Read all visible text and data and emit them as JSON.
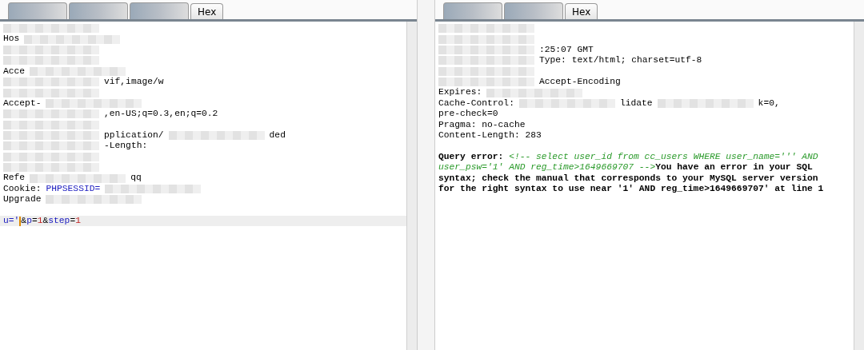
{
  "request": {
    "tabs": [
      {
        "kind": "obscured"
      },
      {
        "kind": "obscured"
      },
      {
        "kind": "obscured"
      },
      {
        "kind": "text",
        "label": "Hex"
      }
    ],
    "lines": [
      [
        {
          "kind": "mosaic"
        }
      ],
      [
        {
          "kind": "plain",
          "text": "Hos"
        },
        {
          "kind": "mosaic"
        }
      ],
      [
        {
          "kind": "mosaic"
        }
      ],
      [
        {
          "kind": "mosaic"
        }
      ],
      [
        {
          "kind": "plain",
          "text": "Acce"
        },
        {
          "kind": "mosaic"
        }
      ],
      [
        {
          "kind": "mosaic"
        },
        {
          "kind": "plain",
          "text": "vif,image/w"
        }
      ],
      [
        {
          "kind": "mosaic"
        }
      ],
      [
        {
          "kind": "plain",
          "text": "Accept-"
        },
        {
          "kind": "mosaic"
        }
      ],
      [
        {
          "kind": "mosaic"
        },
        {
          "kind": "plain",
          "text": ",en-US;q=0.3,en;q=0.2"
        }
      ],
      [
        {
          "kind": "mosaic"
        }
      ],
      [
        {
          "kind": "mosaic"
        },
        {
          "kind": "plain",
          "text": "pplication/"
        },
        {
          "kind": "mosaic"
        },
        {
          "kind": "plain",
          "text": "ded"
        }
      ],
      [
        {
          "kind": "mosaic"
        },
        {
          "kind": "plain",
          "text": "-Length:"
        }
      ],
      [
        {
          "kind": "mosaic"
        }
      ],
      [
        {
          "kind": "mosaic"
        }
      ],
      [
        {
          "kind": "plain",
          "text": "Refe"
        },
        {
          "kind": "mosaic"
        },
        {
          "kind": "plain",
          "text": "qq"
        }
      ],
      [
        {
          "kind": "plain",
          "text": "Cookie:"
        },
        {
          "kind": "name",
          "text": "PHPSESSID="
        },
        {
          "kind": "mosaic"
        }
      ],
      [
        {
          "kind": "plain",
          "text": "Upgrade"
        },
        {
          "kind": "mosaic"
        }
      ]
    ],
    "body": [
      {
        "kind": "name",
        "text": "u='"
      },
      {
        "kind": "cursor"
      },
      {
        "kind": "plain",
        "text": "&"
      },
      {
        "kind": "name",
        "text": "p"
      },
      {
        "kind": "plain",
        "text": "="
      },
      {
        "kind": "value",
        "text": "1"
      },
      {
        "kind": "plain",
        "text": "&"
      },
      {
        "kind": "name",
        "text": "step"
      },
      {
        "kind": "plain",
        "text": "="
      },
      {
        "kind": "value",
        "text": "1"
      }
    ]
  },
  "response": {
    "tabs": [
      {
        "kind": "obscured"
      },
      {
        "kind": "obscured"
      },
      {
        "kind": "text",
        "label": "Hex"
      }
    ],
    "lines": [
      [
        {
          "kind": "mosaic"
        }
      ],
      [
        {
          "kind": "mosaic"
        }
      ],
      [
        {
          "kind": "mosaic"
        },
        {
          "kind": "plain",
          "text": ":25:07 GMT"
        }
      ],
      [
        {
          "kind": "mosaic"
        },
        {
          "kind": "plain",
          "text": "Type: text/html; charset=utf-8"
        }
      ],
      [
        {
          "kind": "mosaic"
        }
      ],
      [
        {
          "kind": "mosaic"
        },
        {
          "kind": "plain",
          "text": "Accept-Encoding"
        }
      ],
      [
        {
          "kind": "plain",
          "text": "Expires:"
        },
        {
          "kind": "mosaic"
        }
      ],
      [
        {
          "kind": "plain",
          "text": "Cache-Control:"
        },
        {
          "kind": "mosaic"
        },
        {
          "kind": "plain",
          "text": "lidate"
        },
        {
          "kind": "mosaic"
        },
        {
          "kind": "plain",
          "text": "k=0,"
        }
      ],
      [
        {
          "kind": "plain",
          "text": "pre-check=0"
        }
      ],
      [
        {
          "kind": "plain",
          "text": "Pragma: no-cache"
        }
      ],
      [
        {
          "kind": "plain",
          "text": "Content-Length: 283"
        }
      ]
    ],
    "error": {
      "label": "Query error:",
      "comment": "<!-- select user_id from cc_users WHERE user_name=''' AND user_psw='1' AND reg_time>1649669707 -->",
      "message": "You have an error in your SQL syntax; check the manual that corresponds to your MySQL server version for the right syntax to use near '1' AND reg_time>1649669707' at line 1"
    }
  }
}
